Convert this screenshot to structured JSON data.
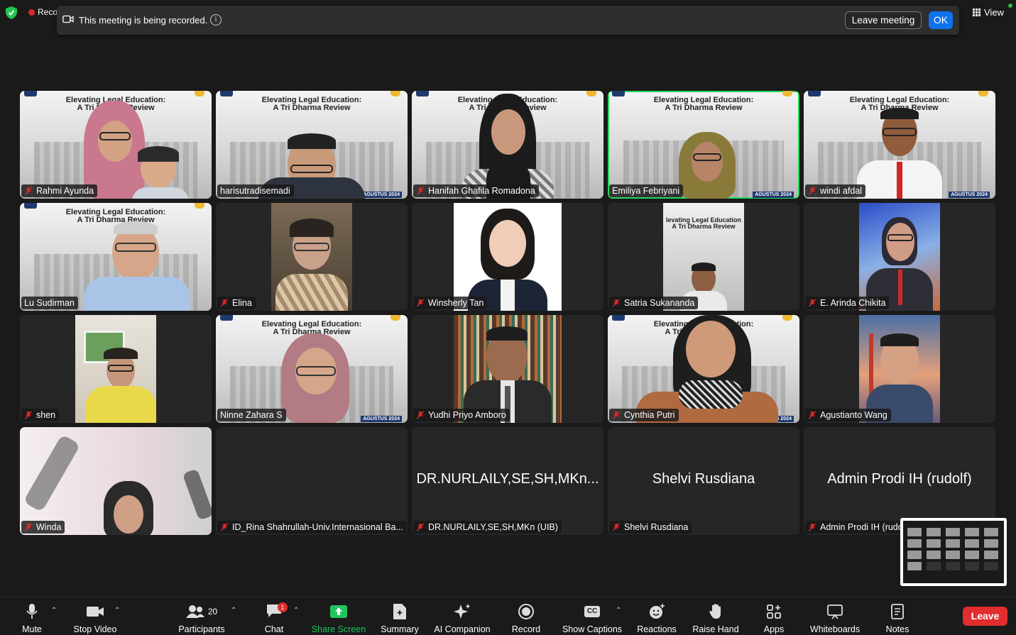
{
  "top": {
    "recording_label": "Reco",
    "banner_message": "This meeting is being recorded.",
    "leave_meeting_label": "Leave meeting",
    "ok_label": "OK",
    "view_label": "View"
  },
  "slide": {
    "title_line1": "Elevating Legal Education:",
    "title_line2": "A Tri Dharma Review",
    "date_text": "AGUSTUS 2024"
  },
  "participants": [
    {
      "name": "Rahmi Ayunda"
    },
    {
      "name": "harisutradisemadi"
    },
    {
      "name": "Hanifah Ghafila Romadona"
    },
    {
      "name": "Emiliya Febriyani"
    },
    {
      "name": "windi afdal"
    },
    {
      "name": "Lu Sudirman"
    },
    {
      "name": "Elina"
    },
    {
      "name": "Winsherly Tan"
    },
    {
      "name": "Satria Sukananda"
    },
    {
      "name": "E. Arinda Chikita"
    },
    {
      "name": "shen"
    },
    {
      "name": "Ninne Zahara S"
    },
    {
      "name": "Yudhi Priyo Amboro"
    },
    {
      "name": "Cynthia Putri"
    },
    {
      "name": "Agustianto Wang"
    },
    {
      "name": "Winda"
    },
    {
      "name": "ID_Rina Shahrullah-Univ.Internasional Ba..."
    },
    {
      "name": "DR.NURLAILY,SE,SH,MKn (UIB)",
      "display": "DR.NURLAILY,SE,SH,MKn..."
    },
    {
      "name": "Shelvi Rusdiana",
      "display": "Shelvi Rusdiana"
    },
    {
      "name": "Admin Prodi IH (rudo",
      "display": "Admin Prodi IH (rudolf)"
    }
  ],
  "toolbar": {
    "mute": "Mute",
    "stop_video": "Stop Video",
    "participants": "Participants",
    "participants_count": "20",
    "chat": "Chat",
    "chat_badge": "1",
    "share_screen": "Share Screen",
    "summary": "Summary",
    "ai_companion": "AI Companion",
    "record": "Record",
    "show_captions": "Show Captions",
    "cc": "CC",
    "reactions": "Reactions",
    "raise_hand": "Raise Hand",
    "apps": "Apps",
    "whiteboards": "Whiteboards",
    "notes": "Notes",
    "leave": "Leave"
  },
  "colors": {
    "background": "#1a1a1a",
    "tile": "#262626",
    "active_speaker": "#23d95b",
    "ok_blue": "#0e72ed",
    "leave_red": "#e12d2d",
    "share_green": "#22c35d",
    "muted_red": "#e02828"
  }
}
